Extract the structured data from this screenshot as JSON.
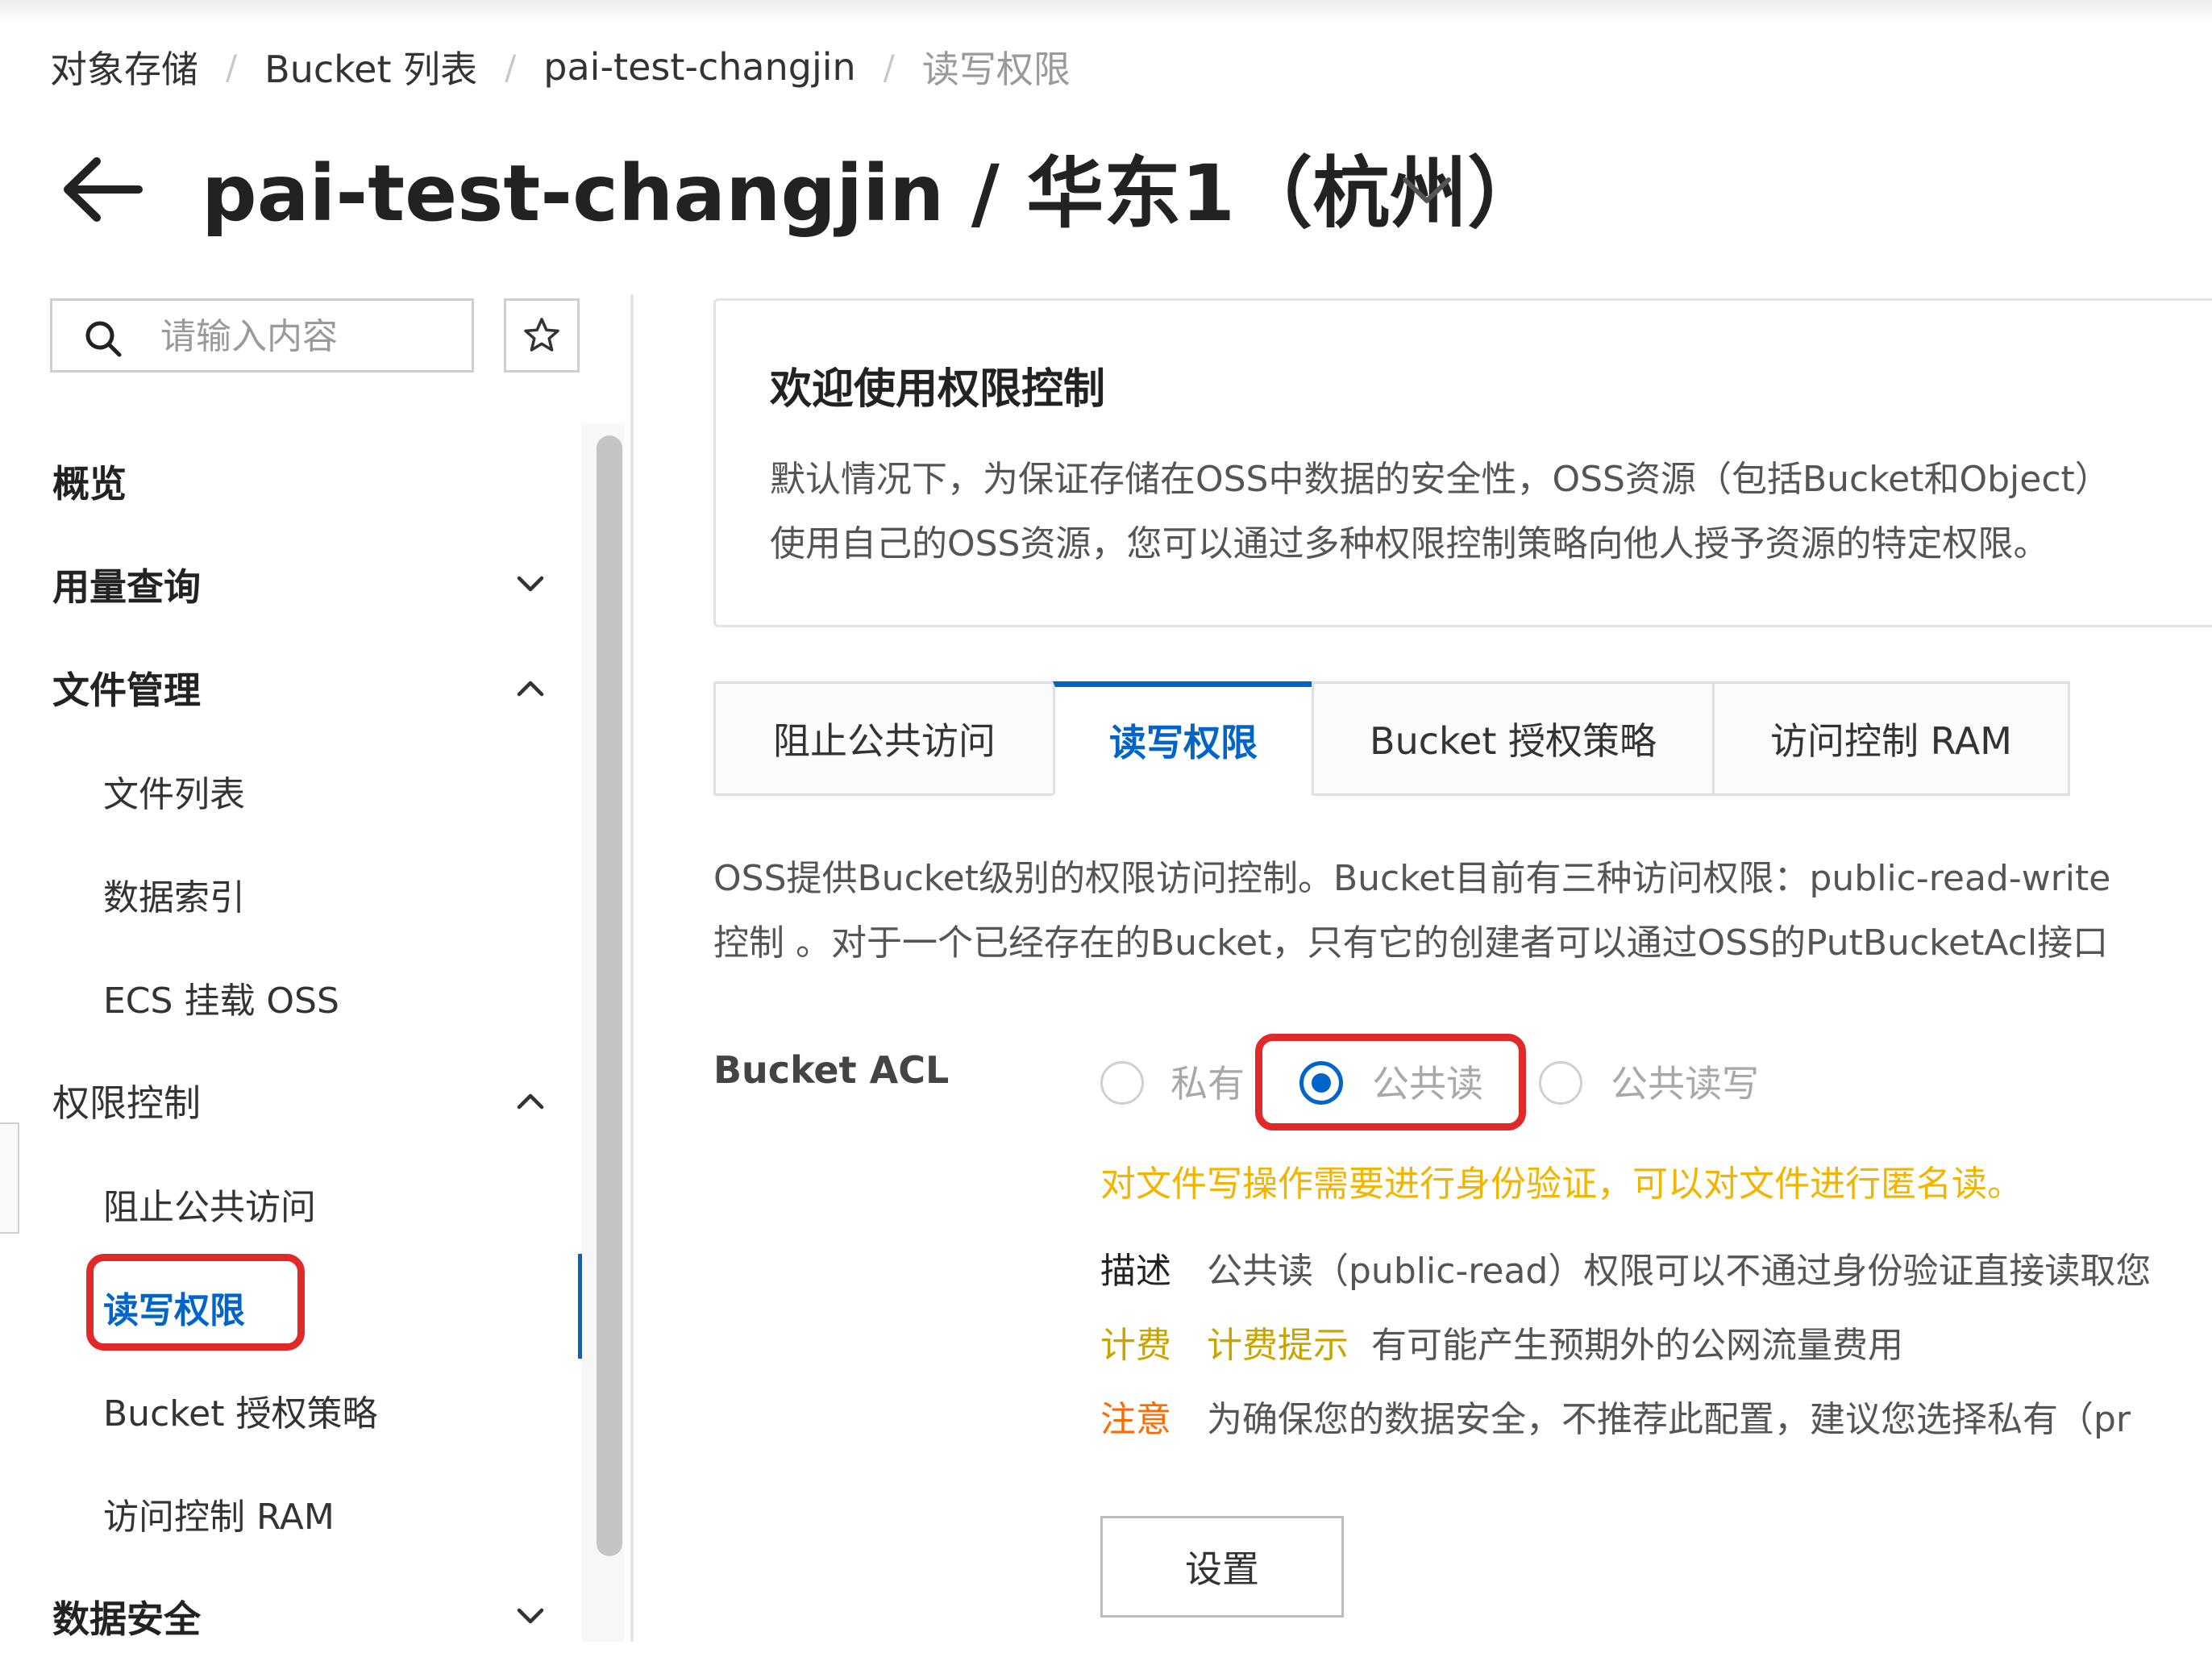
{
  "breadcrumb": [
    "对象存储",
    "Bucket 列表",
    "pai-test-changjin",
    "读写权限"
  ],
  "breadcrumb_separator": "/",
  "header": {
    "title": "pai-test-changjin / 华东1（杭州）"
  },
  "search": {
    "placeholder": "请输入内容"
  },
  "sidebar": {
    "items": [
      {
        "label": "概览"
      },
      {
        "label": "用量查询"
      },
      {
        "label": "文件管理"
      },
      {
        "label": "文件列表"
      },
      {
        "label": "数据索引"
      },
      {
        "label": "ECS 挂载 OSS"
      },
      {
        "label": "权限控制"
      },
      {
        "label": "阻止公共访问"
      },
      {
        "label": "读写权限"
      },
      {
        "label": "Bucket 授权策略"
      },
      {
        "label": "访问控制 RAM"
      },
      {
        "label": "数据安全"
      }
    ]
  },
  "welcome": {
    "title": "欢迎使用权限控制",
    "line1": "默认情况下，为保证存储在OSS中数据的安全性，OSS资源（包括Bucket和Object）",
    "line2": "使用自己的OSS资源，您可以通过多种权限控制策略向他人授予资源的特定权限。"
  },
  "tabs": [
    {
      "label": "阻止公共访问"
    },
    {
      "label": "读写权限"
    },
    {
      "label": "Bucket 授权策略"
    },
    {
      "label": "访问控制 RAM"
    }
  ],
  "info": {
    "line1": "OSS提供Bucket级别的权限访问控制。Bucket目前有三种访问权限：public-read-write",
    "line2": "控制 。对于一个已经存在的Bucket，只有它的创建者可以通过OSS的PutBucketAcl接口"
  },
  "acl": {
    "label": "Bucket ACL",
    "options": [
      "私有",
      "公共读",
      "公共读写"
    ],
    "selected": "公共读",
    "warning": "对文件写操作需要进行身份验证，可以对文件进行匿名读。",
    "desc_key": "描述",
    "desc_value": "公共读（public-read）权限可以不通过身份验证直接读取您",
    "fee_key": "计费",
    "fee_link": "计费提示",
    "fee_value": "有可能产生预期外的公网流量费用",
    "note_key": "注意",
    "note_value": "为确保您的数据安全，不推荐此配置，建议您选择私有（pr"
  },
  "buttons": {
    "set_label": "设置"
  },
  "colors": {
    "accent": "#0064c8",
    "highlight": "#e02a2a",
    "warning": "#f3b400",
    "note": "#ff6a00"
  },
  "icons": [
    "back-arrow-icon",
    "chevron-down-icon",
    "search-icon",
    "star-icon",
    "chevron-up-icon"
  ]
}
